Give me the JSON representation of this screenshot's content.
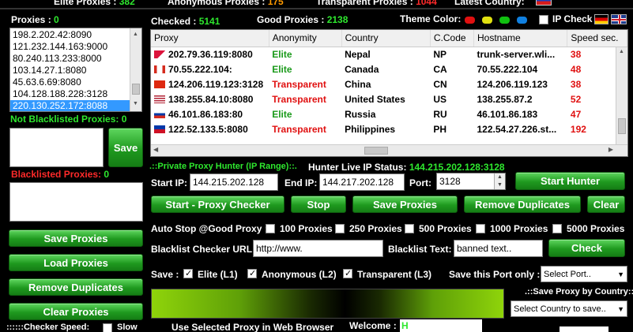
{
  "top": {
    "elite_label": "Elite Proxies :",
    "elite_value": "382",
    "anon_label": "Anonymous  Proxies :",
    "anon_value": "175",
    "trans_label": "Transparent Proxies :",
    "trans_value": "1044",
    "country_label": "Latest Country:"
  },
  "left": {
    "proxies_label": "Proxies :",
    "proxies_value": "0",
    "list": [
      "198.2.202.42:8090",
      "121.232.144.163:9000",
      "80.240.113.233:8000",
      "103.14.27.1:8080",
      "45.63.6.69:8080",
      "104.128.188.228:3128",
      "220.130.252.172:8088"
    ],
    "selected_index": 6,
    "not_blacklisted_label": "Not Blacklisted Proxies:",
    "not_blacklisted_value": "0",
    "save_label": "Save",
    "blacklisted_label": "Blacklisted Proxies:",
    "blacklisted_value": "0",
    "save_proxies": "Save Proxies",
    "load_proxies": "Load Proxies",
    "remove_duplicates": "Remove Duplicates",
    "clear_proxies": "Clear Proxies",
    "checker_speed_label": "::::::Checker Speed:",
    "slow_label": "Slow"
  },
  "stats": {
    "checked_label": "Checked :",
    "checked_value": "5141",
    "good_label": "Good Proxies :",
    "good_value": "2138",
    "theme_label": "Theme Color:",
    "theme_colors": [
      "#e01010",
      "#e0e010",
      "#10c010",
      "#1080e0"
    ],
    "ipcheck_label": "IP Check"
  },
  "grid": {
    "columns": [
      "Proxy",
      "Anonymity",
      "Country",
      "C.Code",
      "Hostname",
      "Speed sec."
    ],
    "rows": [
      {
        "proxy": "202.79.36.119:8080",
        "anon": "Elite",
        "country": "Nepal",
        "code": "NP",
        "host": "trunk-server.wli...",
        "speed": "38"
      },
      {
        "proxy": "70.55.222.104:",
        "anon": "Elite",
        "country": "Canada",
        "code": "CA",
        "host": "70.55.222.104",
        "speed": "48"
      },
      {
        "proxy": "124.206.119.123:3128",
        "anon": "Transparent",
        "country": "China",
        "code": "CN",
        "host": "124.206.119.123",
        "speed": "38"
      },
      {
        "proxy": "138.255.84.10:8080",
        "anon": "Transparent",
        "country": "United States",
        "code": "US",
        "host": "138.255.87.2",
        "speed": "52"
      },
      {
        "proxy": "46.101.86.183:80",
        "anon": "Elite",
        "country": "Russia",
        "code": "RU",
        "host": "46.101.86.183",
        "speed": "47"
      },
      {
        "proxy": "122.52.133.5:8080",
        "anon": "Transparent",
        "country": "Philippines",
        "code": "PH",
        "host": "122.54.27.226.st...",
        "speed": "192"
      }
    ]
  },
  "hunter": {
    "title": ".::Private Proxy Hunter (IP Range)::.",
    "live_label": "Hunter Live IP Status:",
    "live_value": "144.215.202.128:3128",
    "start_ip_label": "Start IP:",
    "start_ip": "144.215.202.128",
    "end_ip_label": "End IP:",
    "end_ip": "144.217.202.128",
    "port_label": "Port:",
    "port": "3128",
    "start_hunter": "Start Hunter"
  },
  "actions": {
    "start_checker": "Start - Proxy Checker",
    "stop": "Stop",
    "save_proxies": "Save Proxies",
    "remove_duplicates": "Remove Duplicates",
    "clear": "Clear"
  },
  "autostop": {
    "label": "Auto Stop @Good Proxy :",
    "options": [
      "100 Proxies",
      "250 Proxies",
      "500 Proxies",
      "1000 Proxies",
      "5000 Proxies"
    ]
  },
  "blacklist": {
    "url_label": "Blacklist Checker URL:",
    "url_value": "http://www.",
    "text_label": "Blacklist Text:",
    "text_value": "banned text..",
    "check": "Check"
  },
  "save": {
    "label": "Save :",
    "elite": "Elite (L1)",
    "anonymous": "Anonymous (L2)",
    "transparent": "Transparent (L3)",
    "port_only_label": "Save this Port only :",
    "port_select": "Select Port..",
    "by_country_label": ".::Save Proxy by Country::.",
    "country_select": "Select Country to save.."
  },
  "bottom": {
    "browser_label": "Use Selected Proxy in Web Browser",
    "welcome_label": "Welcome :",
    "welcome_value": "H"
  }
}
